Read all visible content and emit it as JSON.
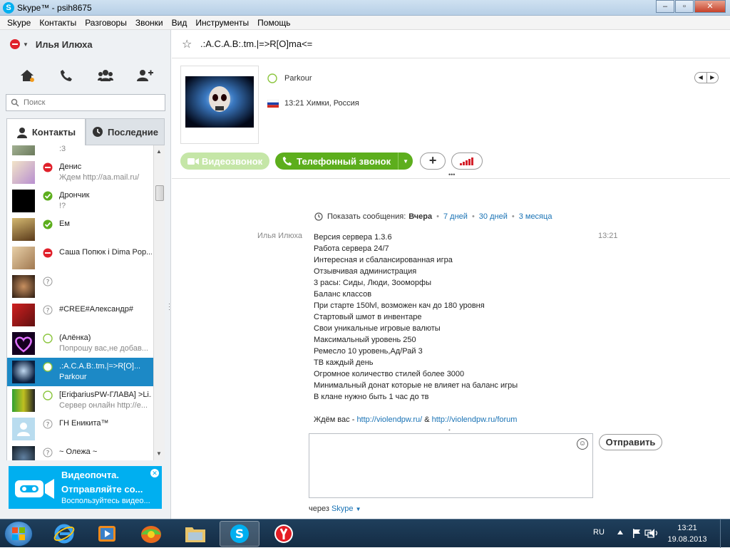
{
  "window": {
    "title": "Skype™ - psih8675",
    "buttons": {
      "minimize": "–",
      "maximize": "▫",
      "close": "✕"
    }
  },
  "menu": [
    "Skype",
    "Контакты",
    "Разговоры",
    "Звонки",
    "Вид",
    "Инструменты",
    "Помощь"
  ],
  "profile": {
    "name": "Илья Илюха",
    "status": "dnd",
    "status_color": "#e0212b"
  },
  "toolbar_icons": [
    "home-icon",
    "phone-icon",
    "group-icon",
    "add-contact-icon"
  ],
  "search": {
    "placeholder": "Поиск",
    "value": ""
  },
  "tabs": {
    "contacts": "Контакты",
    "recent": "Последние",
    "active": "contacts"
  },
  "contacts": [
    {
      "name": "",
      "message": ":3",
      "status": "none"
    },
    {
      "name": "Денис",
      "message": "Ждем http://aa.mail.ru/",
      "status": "dnd"
    },
    {
      "name": "Дрончик",
      "message": "!?",
      "status": "online"
    },
    {
      "name": "Ем",
      "message": "",
      "status": "online"
    },
    {
      "name": "Саша Попюк і Dima Pop...",
      "message": "",
      "status": "dnd"
    },
    {
      "name": "",
      "message": "",
      "status": "unknown"
    },
    {
      "name": "#CREE#Александр#",
      "message": "",
      "status": "unknown"
    },
    {
      "name": "(Алёнка)",
      "message": "Попрошу вас,не добав...",
      "status": "offline"
    },
    {
      "name": ".:A.C.A.B:.tm.|=>R[O]...",
      "message": "Parkour",
      "status": "offline",
      "selected": true
    },
    {
      "name": "[EriфariusPW-ГЛАВА] >Li...",
      "message": "Сервер онлайн http://e...",
      "status": "offline"
    },
    {
      "name": "ГН Еникита™",
      "message": "",
      "status": "unknown"
    },
    {
      "name": "~ Олежа ~",
      "message": "",
      "status": "unknown"
    }
  ],
  "promo": {
    "line1": "Видеопочта.",
    "line2": "Отправляйте со...",
    "line3": "Воспользуйтесь видео..."
  },
  "chat": {
    "name": ".:A.C.A.B:.tm.|=>R[O]ma<=",
    "mood": "Parkour",
    "local_time": "13:21 Химки, Россия",
    "buttons": {
      "video": "Видеозвонок",
      "call": "Телефонный звонок"
    },
    "history": {
      "label": "Показать сообщения:",
      "selected": "Вчера",
      "options": [
        "7 дней",
        "30 дней",
        "3 месяца"
      ]
    },
    "message": {
      "sender": "Илья Илюха",
      "time": "13:21",
      "lines": [
        "Версия сервера 1.3.6",
        "Работа сервера 24/7",
        "Интересная и сбалансированная игра",
        "Отзывчивая администрация",
        "3 расы: Сиды, Люди, Зооморфы",
        "Баланс классов",
        "При старте 150lvl, возможен кач до 180 уровня",
        "Стартовый шмот в инвентаре",
        "Свои уникальные игровые валюты",
        "Максимальный уровень 250",
        "Ремесло 10 уровень,Ад/Рай 3",
        "ТВ каждый день",
        "Огромное количество стилей более 3000",
        "Минимальный донат которые не влияет на баланс игры",
        "В клане нужно быть 1 час до тв"
      ],
      "link_prefix": "Ждём вас - ",
      "link1": "http://violendpw.ru/",
      "link_sep": " & ",
      "link2": "http://violendpw.ru/forum"
    },
    "input": {
      "value": ""
    },
    "send": "Отправить",
    "via": {
      "prefix": "через",
      "service": "Skype"
    }
  },
  "taskbar": {
    "lang": "RU",
    "time": "13:21",
    "date": "19.08.2013"
  },
  "colors": {
    "skype_blue": "#00aff0",
    "selected": "#1c89c6",
    "online": "#5dae1d",
    "dnd": "#e0212b"
  }
}
